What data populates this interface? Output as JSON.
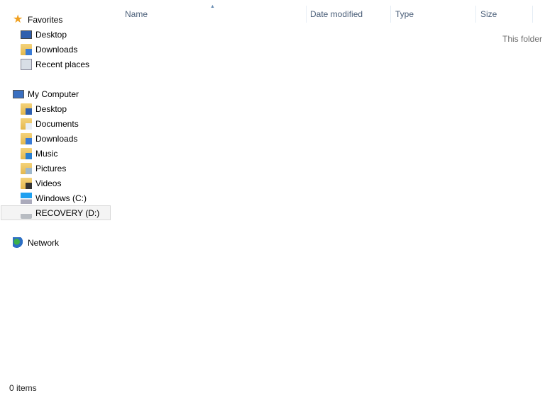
{
  "nav": {
    "favorites": {
      "label": "Favorites",
      "items": [
        {
          "label": "Desktop"
        },
        {
          "label": "Downloads"
        },
        {
          "label": "Recent places"
        }
      ]
    },
    "computer": {
      "label": "My Computer",
      "items": [
        {
          "label": "Desktop"
        },
        {
          "label": "Documents"
        },
        {
          "label": "Downloads"
        },
        {
          "label": "Music"
        },
        {
          "label": "Pictures"
        },
        {
          "label": "Videos"
        },
        {
          "label": "Windows (C:)"
        },
        {
          "label": "RECOVERY (D:)"
        }
      ]
    },
    "network": {
      "label": "Network"
    }
  },
  "columns": {
    "name": "Name",
    "date": "Date modified",
    "type": "Type",
    "size": "Size"
  },
  "empty_text": "This folder",
  "status": "0 items",
  "colors": {
    "header_text": "#4c607a",
    "selection_bg": "#f4f4f4"
  }
}
